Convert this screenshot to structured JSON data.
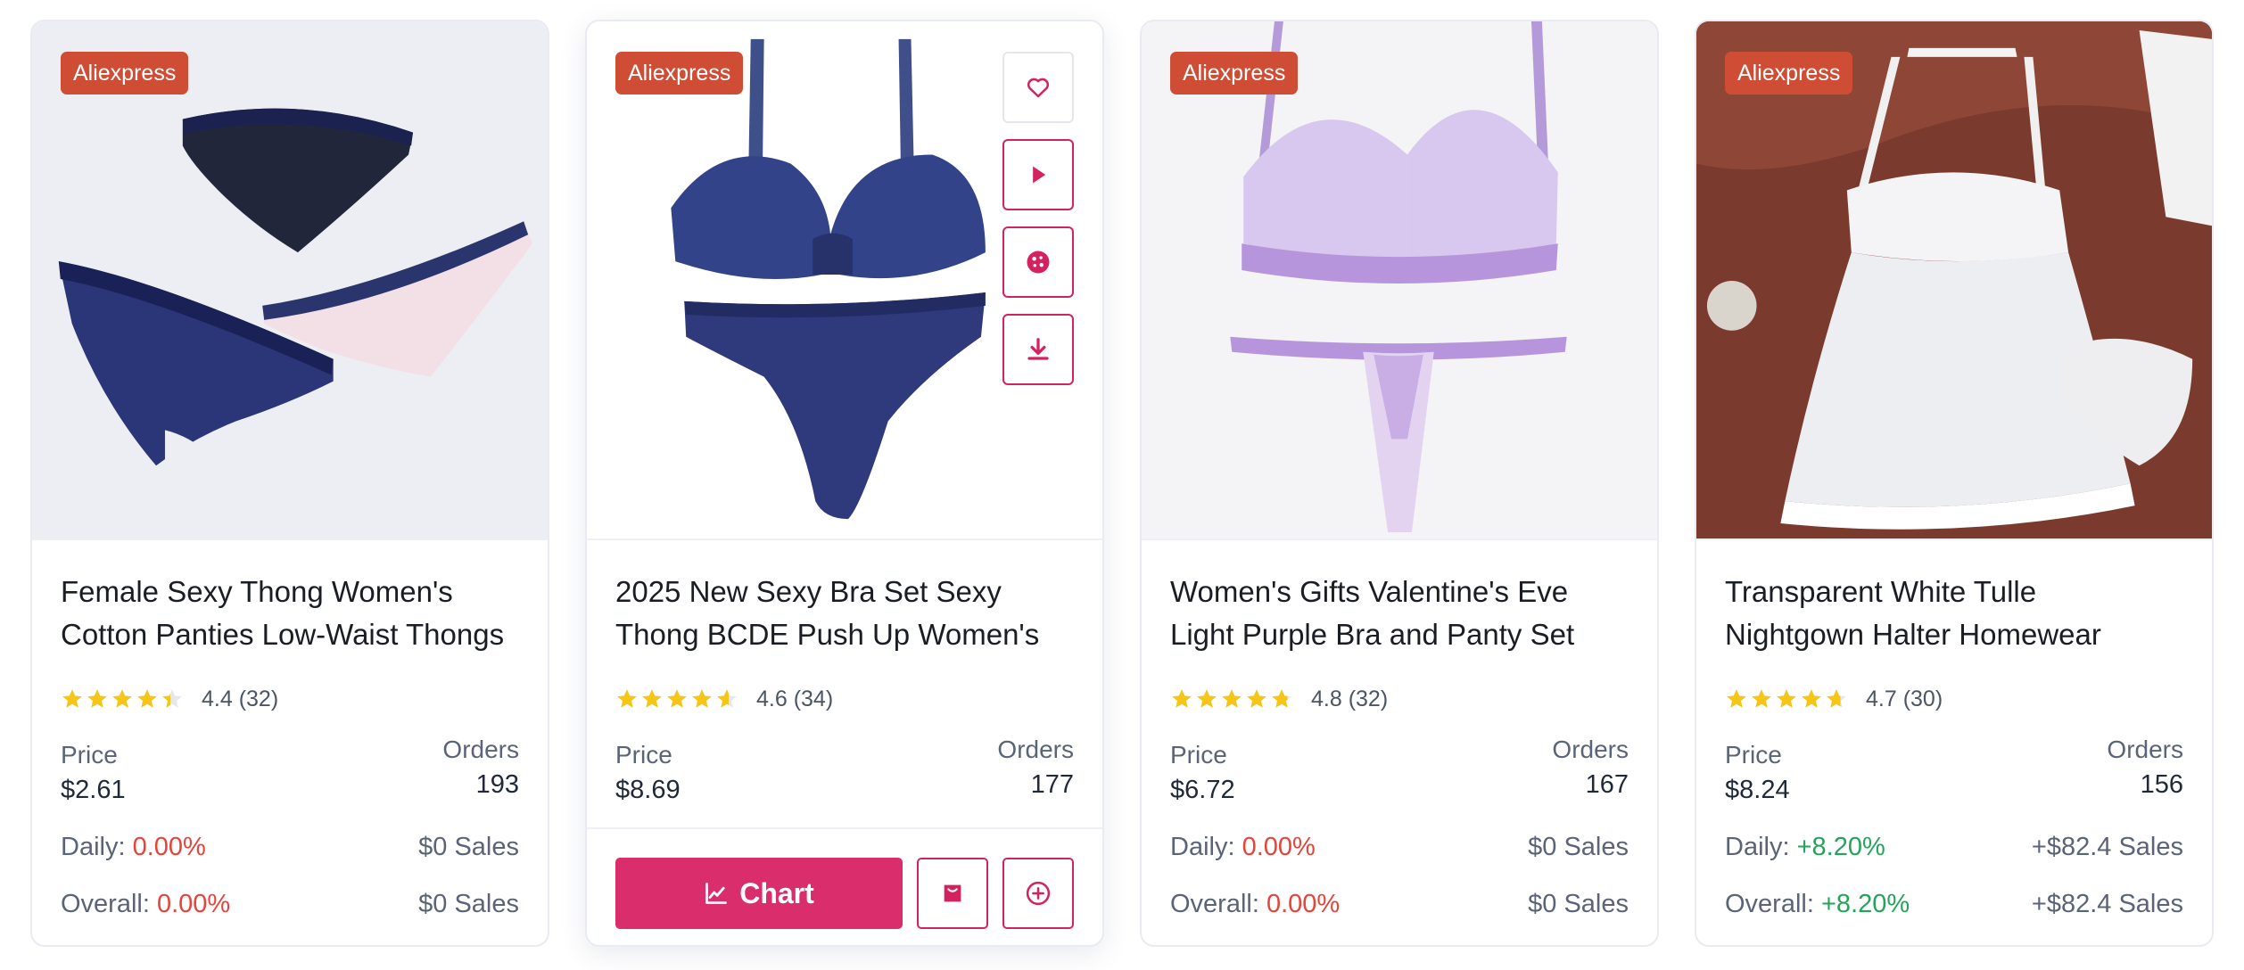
{
  "products": [
    {
      "source": "Aliexpress",
      "title": "Female Sexy Thong Women's Cotton Panties Low-Waist Thongs",
      "rating_text": "4.4 (32)",
      "rating": 4.4,
      "price_label": "Price",
      "price": "$2.61",
      "orders_label": "Orders",
      "orders": "193",
      "daily_label": "Daily:",
      "daily_pct": "0.00%",
      "daily_sales": "$0 Sales",
      "overall_label": "Overall:",
      "overall_pct": "0.00%",
      "overall_sales": "$0 Sales",
      "trend": "neutral"
    },
    {
      "source": "Aliexpress",
      "title": "2025 New Sexy Bra Set Sexy Thong BCDE Push Up Women's",
      "rating_text": "4.6 (34)",
      "rating": 4.6,
      "price_label": "Price",
      "price": "$8.69",
      "orders_label": "Orders",
      "orders": "177",
      "chart_button_label": "Chart",
      "trend": "neutral"
    },
    {
      "source": "Aliexpress",
      "title": "Women's Gifts Valentine's Eve Light Purple Bra and Panty Set",
      "rating_text": "4.8 (32)",
      "rating": 4.8,
      "price_label": "Price",
      "price": "$6.72",
      "orders_label": "Orders",
      "orders": "167",
      "daily_label": "Daily:",
      "daily_pct": "0.00%",
      "daily_sales": "$0 Sales",
      "overall_label": "Overall:",
      "overall_pct": "0.00%",
      "overall_sales": "$0 Sales",
      "trend": "neutral"
    },
    {
      "source": "Aliexpress",
      "title": "Transparent White Tulle Nightgown Halter Homewear",
      "rating_text": "4.7 (30)",
      "rating": 4.7,
      "price_label": "Price",
      "price": "$8.24",
      "orders_label": "Orders",
      "orders": "156",
      "daily_label": "Daily:",
      "daily_pct": "+8.20%",
      "daily_sales": "+$82.4 Sales",
      "overall_label": "Overall:",
      "overall_pct": "+8.20%",
      "overall_sales": "+$82.4 Sales",
      "trend": "positive"
    }
  ],
  "icons": {
    "favorite": "heart-icon",
    "video": "play-icon",
    "cookie": "cookie-icon",
    "download": "download-icon",
    "chart": "line-chart-icon",
    "store": "shopping-bag-icon",
    "add": "plus-circle-icon"
  },
  "colors": {
    "accent": "#da2d6b",
    "badge": "#cf4d35",
    "negative": "#e5443a",
    "positive": "#22a55a",
    "star": "#f5c518"
  }
}
